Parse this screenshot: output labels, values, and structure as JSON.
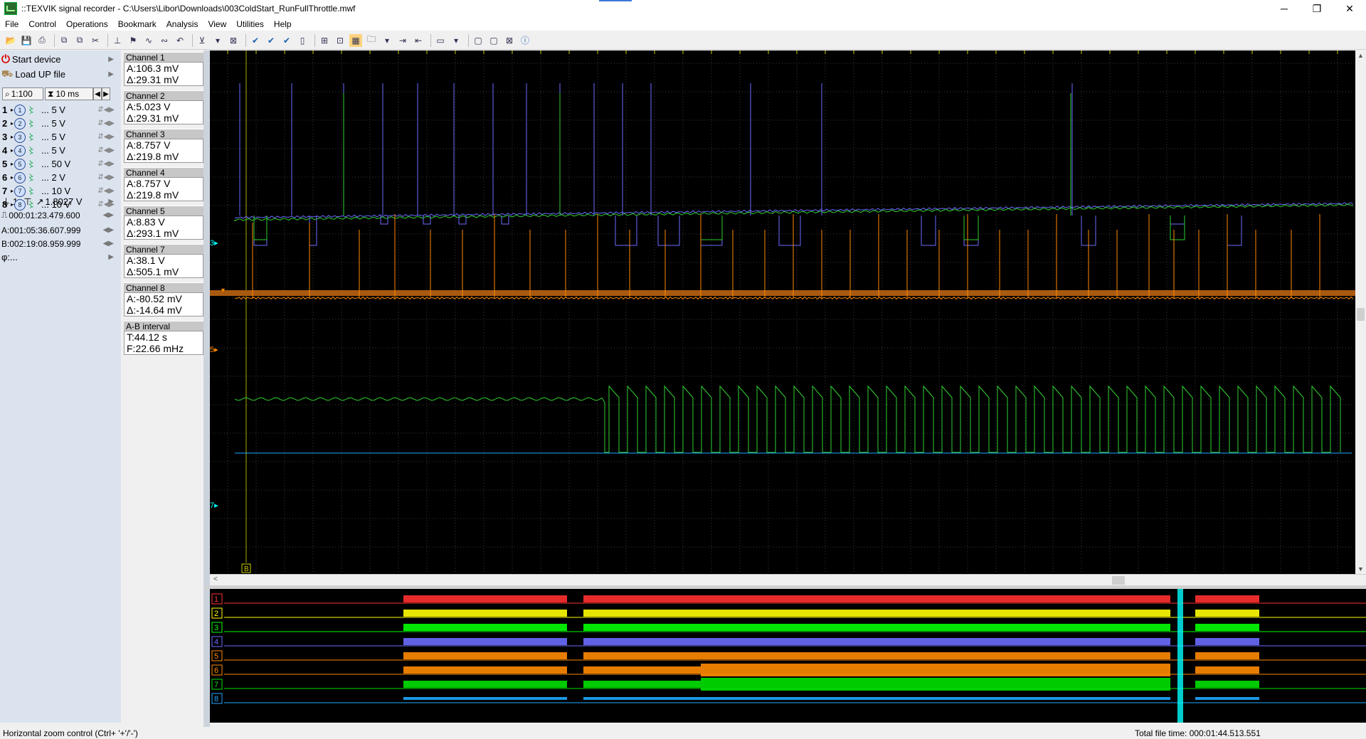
{
  "window": {
    "title": "::TEXVIK  signal recorder - C:\\Users\\Libor\\Downloads\\003ColdStart_RunFullThrottle.mwf",
    "minimize": "─",
    "maximize": "❐",
    "close": "✕"
  },
  "menu": [
    "File",
    "Control",
    "Operations",
    "Bookmark",
    "Analysis",
    "View",
    "Utilities",
    "Help"
  ],
  "toolbar_icons": [
    "open-icon",
    "save-icon",
    "print-icon",
    "copy-icon",
    "paste-icon",
    "cut-icon",
    "cursor-icon",
    "marker-icon",
    "wave-icon",
    "wave2-icon",
    "undo-icon",
    "filter-icon",
    "dropdown-icon",
    "delete-icon",
    "check-icon",
    "check2-icon",
    "check3-icon",
    "page-icon",
    "zoom-fit-icon",
    "zoom-area-icon",
    "grid-icon",
    "folder-icon",
    "dropdown-icon",
    "align-icon",
    "align2-icon",
    "display-icon",
    "dropdown-icon",
    "panel1-icon",
    "panel2-icon",
    "panel3-icon",
    "help-icon"
  ],
  "left_panel": {
    "start_device": "Start device",
    "load_up_file": "Load UP file",
    "zoom_ratio": "1:100",
    "time_div": "10 ms",
    "channels": [
      {
        "num": "1",
        "range": "... 5 V"
      },
      {
        "num": "2",
        "range": "... 5 V"
      },
      {
        "num": "3",
        "range": "... 5 V"
      },
      {
        "num": "4",
        "range": "... 5 V"
      },
      {
        "num": "5",
        "range": "... 50 V"
      },
      {
        "num": "6",
        "range": "... 2 V"
      },
      {
        "num": "7",
        "range": "... 10 V"
      },
      {
        "num": "8",
        "range": "... 10 V"
      }
    ],
    "trigger_channel": "1",
    "trigger_level": "1.8027 V",
    "time_position": "000:01:23.479.600",
    "cursor_a": "A:001:05:36.607.999",
    "cursor_b": "B:002:19:08.959.999",
    "phi": "φ:..."
  },
  "channel_values": [
    {
      "name": "Channel 1",
      "a": "A:106.3 mV",
      "d": "Δ:29.31 mV"
    },
    {
      "name": "Channel 2",
      "a": "A:5.023 V",
      "d": "Δ:29.31 mV"
    },
    {
      "name": "Channel 3",
      "a": "A:8.757 V",
      "d": "Δ:219.8 mV"
    },
    {
      "name": "Channel 4",
      "a": "A:8.757 V",
      "d": "Δ:219.8 mV"
    },
    {
      "name": "Channel 5",
      "a": "A:8.83 V",
      "d": "Δ:293.1 mV"
    },
    {
      "name": "Channel 7",
      "a": "A:38.1 V",
      "d": "Δ:505.1 mV"
    },
    {
      "name": "Channel 8",
      "a": "A:-80.52 mV",
      "d": "Δ:-14.64 mV"
    }
  ],
  "ab_interval": {
    "label": "A-B interval",
    "t": "T:44.12 s",
    "f": "F:22.66 mHz"
  },
  "overview_labels": [
    "1",
    "2",
    "3",
    "4",
    "5",
    "6",
    "7",
    "8"
  ],
  "colors": {
    "ch1": "#ff3030",
    "ch2": "#ffff00",
    "ch3": "#00ff00",
    "ch4": "#6b6bff",
    "ch5": "#ff8a00",
    "ch7": "#00e000",
    "ch8": "#1fa8ff",
    "cursor": "#00ffff"
  },
  "status": {
    "left": "Horizontal zoom control (Ctrl+ '+'/'-')",
    "right": "Total file time: 000:01:44.513.551"
  },
  "cursor_b_marker": "B"
}
